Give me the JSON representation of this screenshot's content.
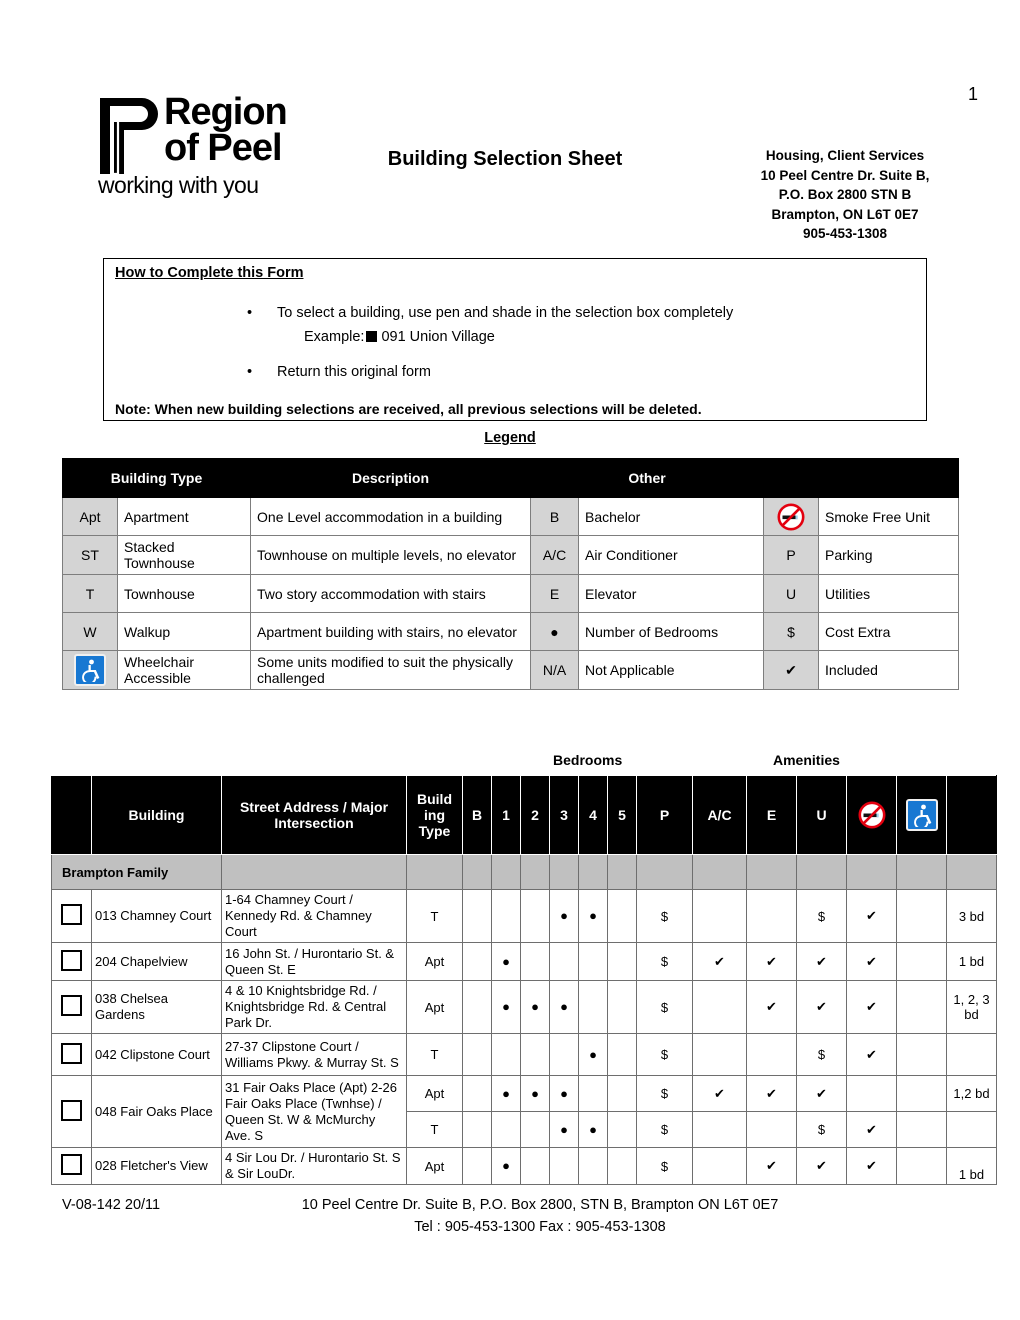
{
  "page_number": "1",
  "header": {
    "logo": {
      "line1": "Region",
      "line2": "of Peel",
      "tagline": "working with you"
    },
    "title": "Building Selection Sheet",
    "address_lines": [
      "Housing, Client Services",
      "10 Peel Centre Dr. Suite B,",
      "P.O. Box 2800 STN B",
      "Brampton, ON L6T 0E7",
      "905-453-1308"
    ]
  },
  "instructions": {
    "title": "How to Complete this Form",
    "bullet1": "To select a building, use pen and shade in the selection box completely",
    "example_label": "Example:",
    "example_text": "091 Union Village",
    "bullet2": "Return this original form",
    "note": "Note:  When new building selections are received, all previous selections will be deleted."
  },
  "legend": {
    "title": "Legend",
    "headers": [
      "Building Type",
      "Description",
      "Other",
      ""
    ],
    "rows": [
      {
        "key": "Apt",
        "name": "Apartment",
        "desc": "One Level accommodation in a building",
        "okey": "B",
        "oval": "Bachelor",
        "xkey": "no-smoking-icon",
        "xval": "Smoke Free Unit"
      },
      {
        "key": "ST",
        "name": "Stacked Townhouse",
        "desc": "Townhouse on multiple levels, no elevator",
        "okey": "A/C",
        "oval": "Air Conditioner",
        "xkey": "P",
        "xval": "Parking"
      },
      {
        "key": "T",
        "name": "Townhouse",
        "desc": "Two story accommodation with stairs",
        "okey": "E",
        "oval": "Elevator",
        "xkey": "U",
        "xval": "Utilities"
      },
      {
        "key": "W",
        "name": "Walkup",
        "desc": "Apartment building with stairs, no elevator",
        "okey": "●",
        "oval": "Number of Bedrooms",
        "xkey": "$",
        "xval": "Cost Extra"
      },
      {
        "key": "wheelchair-icon",
        "name": "Wheelchair Accessible",
        "desc": "Some units modified to suit the physically challenged",
        "okey": "N/A",
        "oval": "Not Applicable",
        "xkey": "✔",
        "xval": "Included"
      }
    ]
  },
  "main_table": {
    "group_labels": {
      "bedrooms": "Bedrooms",
      "amenities": "Amenities"
    },
    "headers": {
      "checkbox": "",
      "building": "Building",
      "address": "Street Address / Major Intersection",
      "building_type": "Build ing Type",
      "b": "B",
      "n1": "1",
      "n2": "2",
      "n3": "3",
      "n4": "4",
      "n5": "5",
      "p": "P",
      "ac": "A/C",
      "e": "E",
      "u": "U",
      "smoke": "no-smoking-icon",
      "wheel": "wheelchair-icon",
      "extra": ""
    },
    "section": "Brampton Family",
    "rows": [
      {
        "name": "013 Chamney Court",
        "address": "1-64 Chamney Court / Kennedy Rd. & Chamney Court",
        "type": "T",
        "b": "",
        "n1": "",
        "n2": "",
        "n3": "●",
        "n4": "●",
        "n5": "",
        "p": "$",
        "ac": "",
        "e": "",
        "u": "$",
        "smoke": "✔",
        "wheel": "",
        "extra": "3 bd"
      },
      {
        "name": "204 Chapelview",
        "address": "16 John St. /  Hurontario St. & Queen St. E",
        "type": "Apt",
        "b": "",
        "n1": "●",
        "n2": "",
        "n3": "",
        "n4": "",
        "n5": "",
        "p": "$",
        "ac": "✔",
        "e": "✔",
        "u": "✔",
        "smoke": "✔",
        "wheel": "",
        "extra": "1 bd"
      },
      {
        "name": "038 Chelsea Gardens",
        "address": "4 & 10 Knightsbridge Rd. / Knightsbridge Rd. & Central Park Dr.",
        "type": "Apt",
        "b": "",
        "n1": "●",
        "n2": "●",
        "n3": "●",
        "n4": "",
        "n5": "",
        "p": "$",
        "ac": "",
        "e": "✔",
        "u": "✔",
        "smoke": "✔",
        "wheel": "",
        "extra": "1, 2, 3 bd"
      },
      {
        "name": "042 Clipstone Court",
        "address": "27-37 Clipstone Court / Williams Pkwy. & Murray St. S",
        "type": "T",
        "b": "",
        "n1": "",
        "n2": "",
        "n3": "",
        "n4": "●",
        "n5": "",
        "p": "$",
        "ac": "",
        "e": "",
        "u": "$",
        "smoke": "✔",
        "wheel": "",
        "extra": ""
      },
      {
        "name": "048 Fair Oaks Place",
        "address": "31 Fair Oaks Place (Apt) 2-26 Fair Oaks Place (Twnhse) / Queen St. W & McMurchy Ave. S",
        "type": "Apt",
        "b": "",
        "n1": "●",
        "n2": "●",
        "n3": "●",
        "n4": "",
        "n5": "",
        "p": "$",
        "ac": "✔",
        "e": "✔",
        "u": "✔",
        "smoke": "",
        "wheel": "",
        "extra": "1,2 bd"
      },
      {
        "name": "",
        "address": "",
        "type": "T",
        "b": "",
        "n1": "",
        "n2": "",
        "n3": "●",
        "n4": "●",
        "n5": "",
        "p": "$",
        "ac": "",
        "e": "",
        "u": "$",
        "smoke": "✔",
        "wheel": "",
        "extra": ""
      },
      {
        "name": "028 Fletcher's View",
        "address": "4 Sir Lou Dr. / Hurontario St. S & Sir LouDr.",
        "type": "Apt",
        "b": "",
        "n1": "●",
        "n2": "",
        "n3": "",
        "n4": "",
        "n5": "",
        "p": "$",
        "ac": "",
        "e": "✔",
        "u": "✔",
        "smoke": "✔",
        "wheel": "",
        "extra": "1 bd"
      }
    ]
  },
  "footer": {
    "form_code": "V-08-142 20/11",
    "line1": "10 Peel Centre Dr. Suite B, P.O. Box 2800, STN B, Brampton ON   L6T 0E7",
    "line2": "Tel : 905-453-1300  Fax : 905-453-1308"
  },
  "colors": {
    "header_black": "#000000",
    "legend_key_gray": "#d4d4d4",
    "section_gray": "#c0c0c0",
    "wheelchair_blue": "#1878d2",
    "nosmoking_red": "#e3000f"
  }
}
